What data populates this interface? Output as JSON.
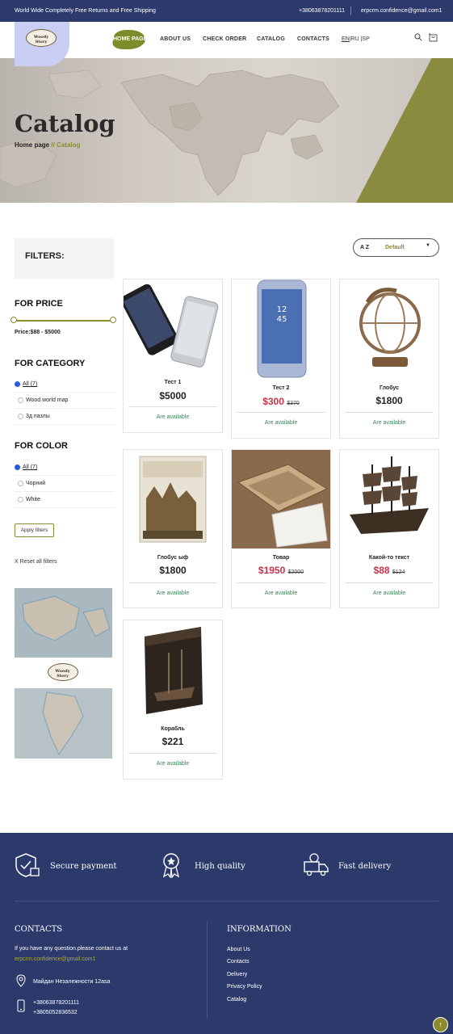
{
  "topbar": {
    "shipping": "World Wide Completely Free Returns and Free Shipping",
    "phone": "+38063878201111",
    "email": "erpcrm.confidence@gmail.com1"
  },
  "logo_text": "Woody Story",
  "nav": {
    "home": "HOME PAGE",
    "about": "ABOUT US",
    "check_order": "CHECK ORDER",
    "catalog": "CATALOG",
    "contacts": "CONTACTS",
    "lang_en": "EN",
    "lang_rest": "|RU |SP"
  },
  "hero": {
    "title": "Catalog",
    "crumb_home": "Home page",
    "crumb_sep": "//",
    "crumb_current": "Catalog"
  },
  "filters": {
    "title": "FILTERS:",
    "price_title": "FOR PRICE",
    "price_range": "Price:$88 - $5000",
    "category_title": "FOR CATEGORY",
    "categories": [
      "All (7)",
      "Wood world map",
      "3д пазлы"
    ],
    "color_title": "FOR COLOR",
    "colors": [
      "All (7)",
      "Чорний",
      "White"
    ],
    "apply": "Apply filters",
    "reset": "X  Reset all filters"
  },
  "sort": {
    "az": "A Z",
    "value": "Default"
  },
  "products": [
    {
      "name": "Тест 1",
      "price": "$5000",
      "old_price": "",
      "status": "Are available"
    },
    {
      "name": "Тест 2",
      "price": "$300",
      "old_price": "$370",
      "status": "Are available"
    },
    {
      "name": "Глобус",
      "price": "$1800",
      "old_price": "",
      "status": "Are available"
    },
    {
      "name": "Глобус ыф",
      "price": "$1800",
      "old_price": "",
      "status": "Are available"
    },
    {
      "name": "Товар",
      "price": "$1950",
      "old_price": "$2000",
      "status": "Are available"
    },
    {
      "name": "Какой-то текст",
      "price": "$88",
      "old_price": "$124",
      "status": "Are available"
    },
    {
      "name": "Корабль",
      "price": "$221",
      "old_price": "",
      "status": "Are available"
    }
  ],
  "features": {
    "secure": "Secure payment",
    "quality": "High quality",
    "delivery": "Fast delivery"
  },
  "footer": {
    "contacts_title": "CONTACTS",
    "contacts_text": "If you have any question.please contact us at",
    "contacts_email": "erpcrm.confidence@gmail.com1",
    "address": "Майдан Незалежности 12asa",
    "phone1": "+38063878201111",
    "phone2": "+3805052836532",
    "info_title": "INFORMATION",
    "links": [
      "About Us",
      "Contacts",
      "Delivery",
      "Privacy Policy",
      "Catalog"
    ]
  },
  "colors": {
    "navy": "#2b3a6b",
    "olive": "#8c8b2d",
    "sale": "#c8334a",
    "available": "#2e8b57"
  }
}
